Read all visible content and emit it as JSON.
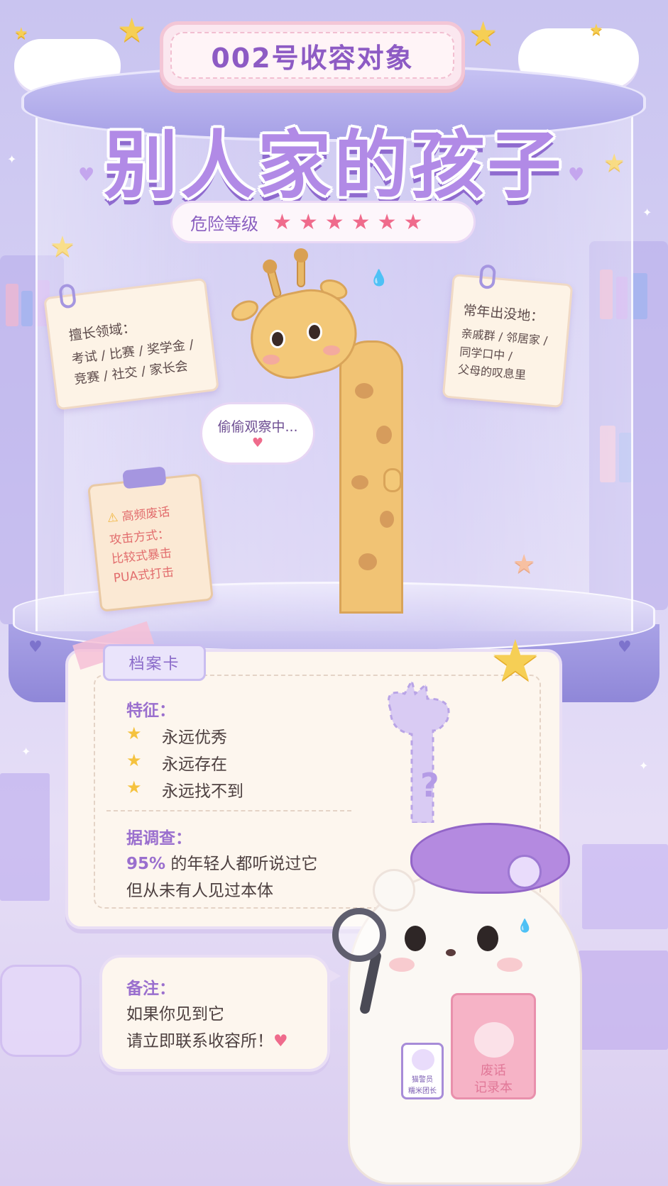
{
  "plaque": {
    "title": "002号收容对象"
  },
  "main_title": "别人家的孩子",
  "danger": {
    "label": "危险等级",
    "stars": "★★★★★★",
    "rating": 6
  },
  "note_skills": {
    "head": "擅长领域：",
    "line1": "考试 / 比赛 / 奖学金 /",
    "line2": "竞赛 / 社交 / 家长会"
  },
  "note_location": {
    "head": "常年出没地：",
    "line1": "亲戚群 / 邻居家 /",
    "line2": "同学口中 /",
    "line3": "父母的叹息里"
  },
  "note_attack": {
    "head": "高频废话",
    "line1": "攻击方式：",
    "line2": "比较式暴击",
    "line3": "PUA式打击"
  },
  "speech_bubble": {
    "text": "偷偷观察中...",
    "heart": "♥"
  },
  "file_card": {
    "tab": "档案卡",
    "features_title": "特征：",
    "features": [
      "永远优秀",
      "永远存在",
      "永远找不到"
    ],
    "survey_title": "据调查：",
    "survey_pct": "95%",
    "survey_line1_rest": " 的年轻人都听说过它",
    "survey_line2": "但从未有人见过本体",
    "silhouette_mark": "?"
  },
  "memo": {
    "title": "备注：",
    "line1": "如果你见到它",
    "line2": "请立即联系收容所！",
    "heart": "♥"
  },
  "mascot": {
    "badge_line1": "猫警员",
    "badge_line2": "糯米团长",
    "notebook_line1": "废话",
    "notebook_line2": "记录本"
  },
  "colors": {
    "accent": "#9a6fce",
    "title": "#b18ae6",
    "danger_star": "#ef6b8c",
    "star": "#f5c23e"
  }
}
